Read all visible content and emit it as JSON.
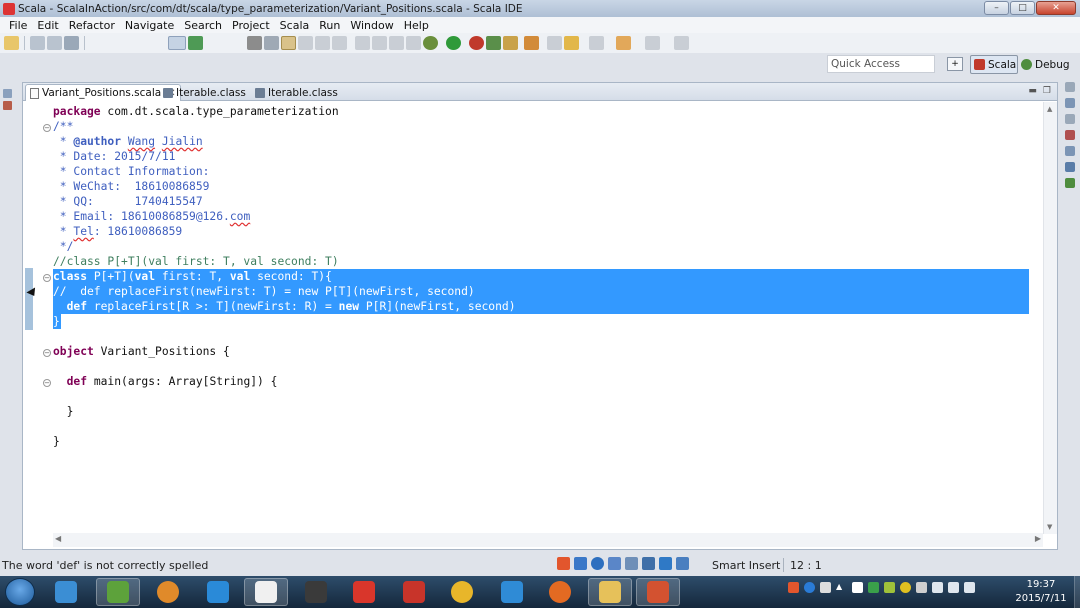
{
  "window": {
    "title": "Scala - ScalaInAction/src/com/dt/scala/type_parameterization/Variant_Positions.scala - Scala IDE",
    "controls": [
      "–",
      "□",
      "✕"
    ]
  },
  "menu": [
    "File",
    "Edit",
    "Refactor",
    "Navigate",
    "Search",
    "Project",
    "Scala",
    "Run",
    "Window",
    "Help"
  ],
  "quick_access": {
    "placeholder": "Quick Access"
  },
  "perspectives": {
    "scala": "Scala",
    "debug": "Debug"
  },
  "tabs": [
    {
      "label": "Variant_Positions.scala",
      "active": true,
      "closable": true
    },
    {
      "label": "Iterable.class",
      "active": false
    },
    {
      "label": "Iterable.class",
      "active": false
    }
  ],
  "code": {
    "l1_kw": "package",
    "l1_rest": " com.dt.scala.type_parameterization",
    "l2": "/**",
    "l3_star": " * ",
    "l3_tag": "@author",
    "l3_sp": " ",
    "l3_a": "Wang",
    "l3_b": " ",
    "l3_c": "Jialin",
    "l4": " * Date: 2015/7/11",
    "l5": " * Contact Information:",
    "l6": " * WeChat:  18610086859",
    "l7": " * QQ:      1740415547",
    "l8_a": " * Email: 18610086859@126.",
    "l8_b": "com",
    "l9_a": " * ",
    "l9_b": "Tel",
    "l9_c": ": 18610086859",
    "l10": " */",
    "l11": "//class P[+T](val first: T, val second: T)",
    "l12_kw1": "class",
    "l12_a": " P[+T](",
    "l12_kw2": "val",
    "l12_b": " first: T, ",
    "l12_kw3": "val",
    "l12_c": " second: T){",
    "l13": "//  def replaceFirst(newFirst: T) = new P[T](newFirst, second)",
    "l14_pre": "  ",
    "l14_kw1": "def",
    "l14_a": " replaceFirst[R >: T](newFirst: R) = ",
    "l14_kw2": "new",
    "l14_b": " P[R](newFirst, second)",
    "l15": "}",
    "l17_kw": "object",
    "l17_rest": " Variant_Positions {",
    "l19_pre": "  ",
    "l19_kw": "def",
    "l19_rest": " main(args: Array[String]) {",
    "l21": "  }",
    "l23": "}"
  },
  "status": {
    "message": "The word 'def' is not correctly spelled",
    "insert_mode": "Smart Insert",
    "position": "12 : 1"
  },
  "clock": {
    "time": "19:37",
    "date": "2015/7/11"
  },
  "colors": {
    "selection": "#3399ff",
    "keyword": "#7f0055",
    "comment": "#3f7f5f",
    "javadoc": "#3f5fbf"
  }
}
